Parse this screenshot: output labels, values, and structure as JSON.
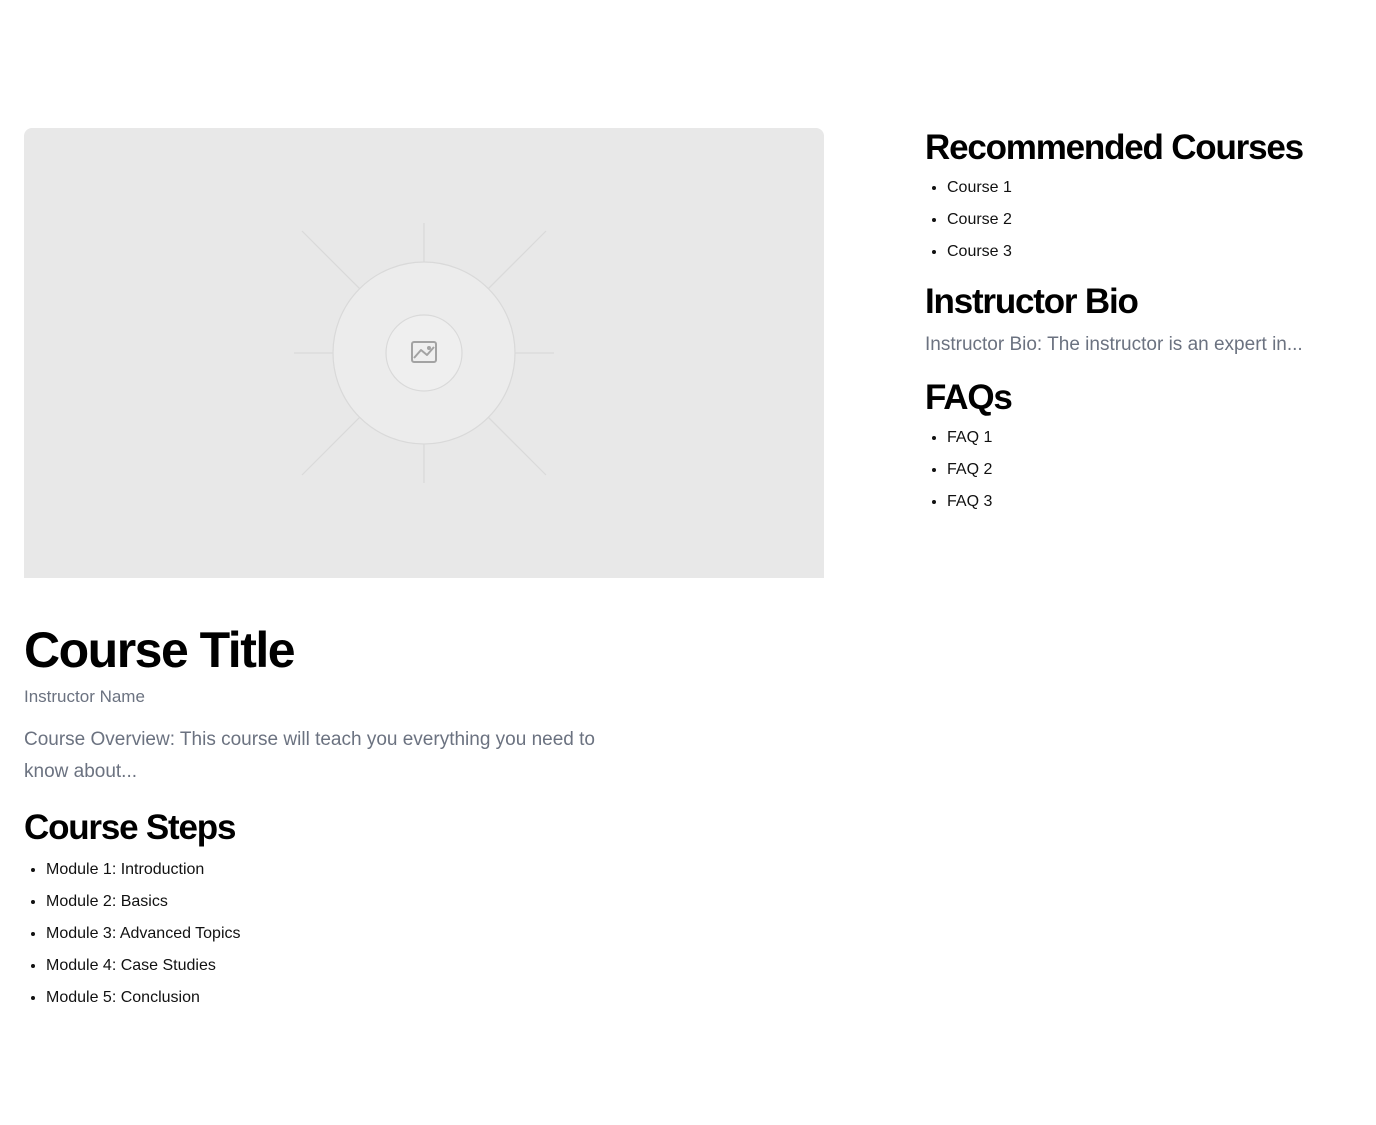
{
  "course": {
    "title": "Course Title",
    "instructor_name": "Instructor Name",
    "overview": "Course Overview: This course will teach you everything you need to know about..."
  },
  "hero_image": {
    "icon": "image-icon",
    "background_color": "#e8e8e8"
  },
  "course_steps": {
    "heading": "Course Steps",
    "items": [
      "Module 1: Introduction",
      "Module 2: Basics",
      "Module 3: Advanced Topics",
      "Module 4: Case Studies",
      "Module 5: Conclusion"
    ]
  },
  "recommended": {
    "heading": "Recommended Courses",
    "items": [
      "Course 1",
      "Course 2",
      "Course 3"
    ]
  },
  "instructor_bio": {
    "heading": "Instructor Bio",
    "text": "Instructor Bio: The instructor is an expert in..."
  },
  "faqs": {
    "heading": "FAQs",
    "items": [
      "FAQ 1",
      "FAQ 2",
      "FAQ 3"
    ]
  },
  "colors": {
    "muted_text": "#6b7280",
    "heading_text": "#000000"
  }
}
